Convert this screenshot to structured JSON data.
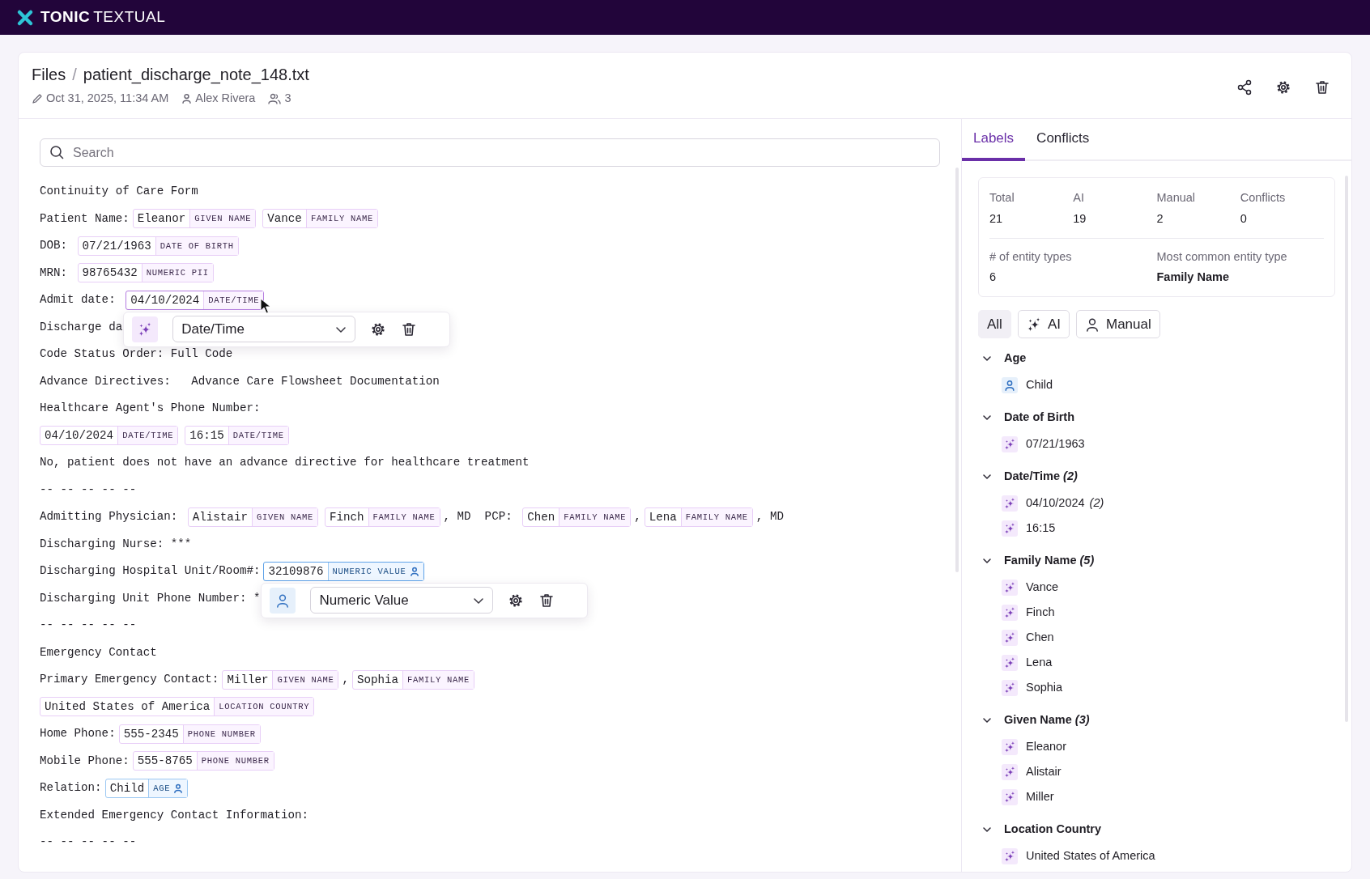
{
  "brand": {
    "primary": "TONIC",
    "secondary": "TEXTUAL"
  },
  "header": {
    "breadcrumb": [
      "Files",
      "patient_discharge_note_148.txt"
    ],
    "separator": "/",
    "edited": "Oct 31, 2025, 11:34 AM",
    "author": "Alex Rivera",
    "collaborators": "3"
  },
  "search": {
    "placeholder": "Search"
  },
  "document": {
    "lines": [
      {
        "segments": [
          {
            "text": "Continuity of Care Form"
          }
        ]
      },
      {
        "segments": [
          {
            "text": "Patient Name:"
          },
          {
            "entity": "Eleanor",
            "label": "GIVEN NAME",
            "manual": false,
            "selected": false
          },
          {
            "entity": "Vance",
            "label": "FAMILY NAME",
            "manual": false,
            "selected": false
          }
        ]
      },
      {
        "segments": [
          {
            "text": "DOB: "
          },
          {
            "entity": "07/21/1963",
            "label": "DATE OF BIRTH",
            "manual": false,
            "selected": false
          }
        ]
      },
      {
        "segments": [
          {
            "text": "MRN: "
          },
          {
            "entity": "98765432",
            "label": "NUMERIC PII",
            "manual": false,
            "selected": false
          }
        ]
      },
      {
        "segments": [
          {
            "text": "Admit date: "
          },
          {
            "entity": "04/10/2024",
            "label": "DATE/TIME",
            "manual": false,
            "selected": true,
            "hovered": true,
            "editor": {
              "manual": false,
              "type": "Date/Time"
            }
          }
        ]
      },
      {
        "segments": [
          {
            "text": "Discharge da"
          }
        ]
      },
      {
        "segments": [
          {
            "text": "Code Status Order: Full Code"
          }
        ]
      },
      {
        "segments": [
          {
            "text": "Advance Directives:   Advance Care Flowsheet Documentation"
          }
        ]
      },
      {
        "segments": [
          {
            "text": "Healthcare Agent's Phone Number:"
          }
        ]
      },
      {
        "segments": [
          {
            "entity": "04/10/2024",
            "label": "DATE/TIME",
            "manual": false,
            "selected": false
          },
          {
            "entity": "16:15",
            "label": "DATE/TIME",
            "manual": false,
            "selected": false
          }
        ]
      },
      {
        "segments": [
          {
            "text": "No, patient does not have an advance directive for healthcare treatment"
          }
        ]
      },
      {
        "segments": [
          {
            "text": "-- -- -- -- --"
          }
        ]
      },
      {
        "segments": [
          {
            "text": "Admitting Physician: "
          },
          {
            "entity": "Alistair",
            "label": "GIVEN NAME",
            "manual": false,
            "selected": false
          },
          {
            "entity": "Finch",
            "label": "FAMILY NAME",
            "manual": false,
            "selected": false
          },
          {
            "text": ", MD  PCP: "
          },
          {
            "entity": "Chen",
            "label": "FAMILY NAME",
            "manual": false,
            "selected": false
          },
          {
            "text": ","
          },
          {
            "entity": "Lena",
            "label": "FAMILY NAME",
            "manual": false,
            "selected": false
          },
          {
            "text": ", MD"
          }
        ]
      },
      {
        "segments": [
          {
            "text": "Discharging Nurse: ***"
          }
        ]
      },
      {
        "segments": [
          {
            "text": "Discharging Hospital Unit/Room#:"
          },
          {
            "entity": "32109876",
            "label": "NUMERIC VALUE",
            "manual": true,
            "selected": true,
            "editor": {
              "manual": true,
              "type": "Numeric Value"
            }
          }
        ]
      },
      {
        "segments": [
          {
            "text": "Discharging Unit Phone Number: *"
          }
        ]
      },
      {
        "segments": [
          {
            "text": "-- -- -- -- --"
          }
        ]
      },
      {
        "segments": [
          {
            "text": "Emergency Contact"
          }
        ]
      },
      {
        "segments": [
          {
            "text": "Primary Emergency Contact:"
          },
          {
            "entity": "Miller",
            "label": "GIVEN NAME",
            "manual": false,
            "selected": false
          },
          {
            "text": ","
          },
          {
            "entity": "Sophia",
            "label": "FAMILY NAME",
            "manual": false,
            "selected": false
          }
        ]
      },
      {
        "segments": [
          {
            "entity": "United States of America",
            "label": "LOCATION COUNTRY",
            "manual": false,
            "selected": false
          }
        ]
      },
      {
        "segments": [
          {
            "text": "Home Phone:"
          },
          {
            "entity": "555-2345",
            "label": "PHONE NUMBER",
            "manual": false,
            "selected": false
          }
        ]
      },
      {
        "segments": [
          {
            "text": "Mobile Phone:"
          },
          {
            "entity": "555-8765",
            "label": "PHONE NUMBER",
            "manual": false,
            "selected": false
          }
        ]
      },
      {
        "segments": [
          {
            "text": "Relation:"
          },
          {
            "entity": "Child",
            "label": "AGE",
            "manual": true,
            "selected": false
          }
        ]
      },
      {
        "segments": [
          {
            "text": "Extended Emergency Contact Information:"
          }
        ]
      },
      {
        "segments": [
          {
            "text": "-- -- -- -- --"
          }
        ]
      }
    ]
  },
  "panel": {
    "tabs": [
      {
        "label": "Labels",
        "selected": true
      },
      {
        "label": "Conflicts",
        "selected": false
      }
    ],
    "stats": [
      {
        "label": "Total",
        "value": "21"
      },
      {
        "label": "AI",
        "value": "19"
      },
      {
        "label": "Manual",
        "value": "2"
      },
      {
        "label": "Conflicts",
        "value": "0"
      }
    ],
    "summary": [
      {
        "label": "# of entity types",
        "value": "6",
        "bold": false
      },
      {
        "label": "Most common entity type",
        "value": "Family Name",
        "bold": true
      }
    ],
    "filters": [
      {
        "label": "All",
        "kind": "all",
        "selected": true
      },
      {
        "label": "AI",
        "kind": "ai",
        "selected": false
      },
      {
        "label": "Manual",
        "kind": "manual",
        "selected": false
      }
    ],
    "groups": [
      {
        "title": "Age",
        "expanded": true,
        "items": [
          {
            "text": "Child",
            "manual": true
          }
        ]
      },
      {
        "title": "Date of Birth",
        "expanded": true,
        "items": [
          {
            "text": "07/21/1963",
            "manual": false
          }
        ]
      },
      {
        "title": "Date/Time",
        "count": "(2)",
        "expanded": true,
        "items": [
          {
            "text": "04/10/2024",
            "count": "(2)",
            "manual": false
          },
          {
            "text": "16:15",
            "manual": false
          }
        ]
      },
      {
        "title": "Family Name",
        "count": "(5)",
        "expanded": true,
        "items": [
          {
            "text": "Vance",
            "manual": false
          },
          {
            "text": "Finch",
            "manual": false
          },
          {
            "text": "Chen",
            "manual": false
          },
          {
            "text": "Lena",
            "manual": false
          },
          {
            "text": "Sophia",
            "manual": false
          }
        ]
      },
      {
        "title": "Given Name",
        "count": "(3)",
        "expanded": true,
        "items": [
          {
            "text": "Eleanor",
            "manual": false
          },
          {
            "text": "Alistair",
            "manual": false
          },
          {
            "text": "Miller",
            "manual": false
          }
        ]
      },
      {
        "title": "Location Country",
        "expanded": true,
        "items": [
          {
            "text": "United States of America",
            "manual": false
          }
        ]
      }
    ]
  }
}
